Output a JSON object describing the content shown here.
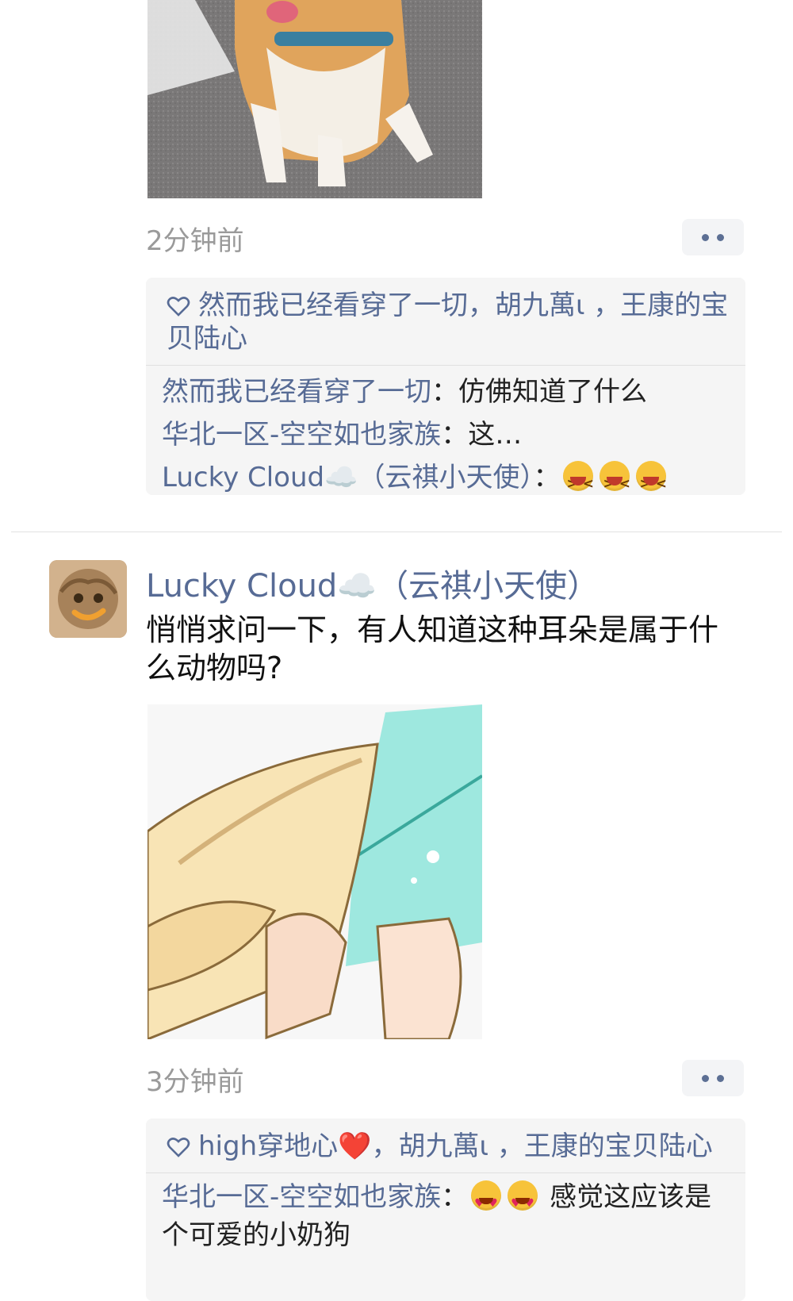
{
  "posts": [
    {
      "time": "2分钟前",
      "likes": "然而我已经看穿了一切，胡九萬ι ，王康的宝贝陆心",
      "comments": [
        {
          "who": "然而我已经看穿了一切",
          "sep": "：",
          "text": "仿佛知道了什么"
        },
        {
          "who": "华北一区-空空如也家族",
          "sep": "：",
          "text": "这…"
        },
        {
          "who": "Lucky Cloud☁️（云祺小天使）",
          "sep": "：",
          "text": ""
        }
      ],
      "comment3_emojis": [
        "laughing-tears-emoji",
        "laughing-tears-emoji",
        "laughing-tears-emoji"
      ]
    },
    {
      "author": "Lucky Cloud☁️（云祺小天使）",
      "text": "悄悄求问一下，有人知道这种耳朵是属于什么动物吗?",
      "time": "3分钟前",
      "likes": "high穿地心❤️，胡九萬ι ，王康的宝贝陆心",
      "comments": [
        {
          "who": "华北一区-空空如也家族",
          "sep": "：",
          "text": " 感觉这应该是个可爱的小奶狗"
        }
      ]
    }
  ],
  "colors": {
    "link": "#576b95",
    "panel": "#f5f5f5",
    "time": "#9a9a9a"
  }
}
